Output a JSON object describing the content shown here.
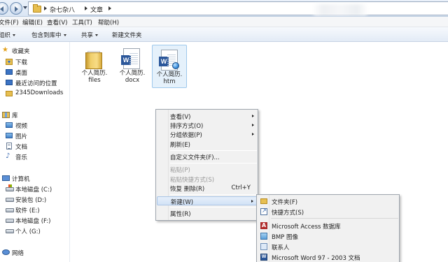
{
  "addressbar": {
    "path": [
      "杂七杂八",
      "文章"
    ]
  },
  "menubar": {
    "items": [
      "文件(F)",
      "编辑(E)",
      "查看(V)",
      "工具(T)",
      "帮助(H)"
    ]
  },
  "toolbar": {
    "organize": "组织",
    "include_in_library": "包含到库中",
    "share": "共享",
    "new_folder": "新建文件夹"
  },
  "navpane": {
    "favorites": {
      "label": "收藏夹",
      "items": [
        "下载",
        "桌面",
        "最近访问的位置",
        "2345Downloads"
      ]
    },
    "libraries": {
      "label": "库",
      "items": [
        "视频",
        "图片",
        "文档",
        "音乐"
      ]
    },
    "computer": {
      "label": "计算机",
      "items": [
        "本地磁盘 (C:)",
        "安装包 (D:)",
        "软件 (E:)",
        "本地磁盘 (F:)",
        "个人 (G:)"
      ]
    },
    "network": {
      "label": "网络"
    }
  },
  "files": [
    {
      "name_line1": "个人简历.",
      "name_line2": "files",
      "type": "folder"
    },
    {
      "name_line1": "个人简历.",
      "name_line2": "docx",
      "type": "word"
    },
    {
      "name_line1": "个人简历.",
      "name_line2": "htm",
      "type": "word-html"
    }
  ],
  "context_menu": {
    "view": "查看(V)",
    "sort_by": "排序方式(O)",
    "group_by": "分组依据(P)",
    "refresh": "刷新(E)",
    "customize_folder": "自定义文件夹(F)...",
    "paste": "粘贴(P)",
    "paste_shortcut": "粘贴快捷方式(S)",
    "undo_delete": "恢复 删除(R)",
    "undo_shortcut": "Ctrl+Y",
    "new": "新建(W)",
    "properties": "属性(R)"
  },
  "new_submenu": {
    "folder": "文件夹(F)",
    "shortcut": "快捷方式(S)",
    "access": "Microsoft Access 数据库",
    "bmp": "BMP 图像",
    "contact": "联系人",
    "word97": "Microsoft Word 97 - 2003 文档"
  },
  "colors": {
    "menu_highlight": "#d2e2f6",
    "folder": "#e7bf51",
    "word_blue": "#2b579a"
  }
}
